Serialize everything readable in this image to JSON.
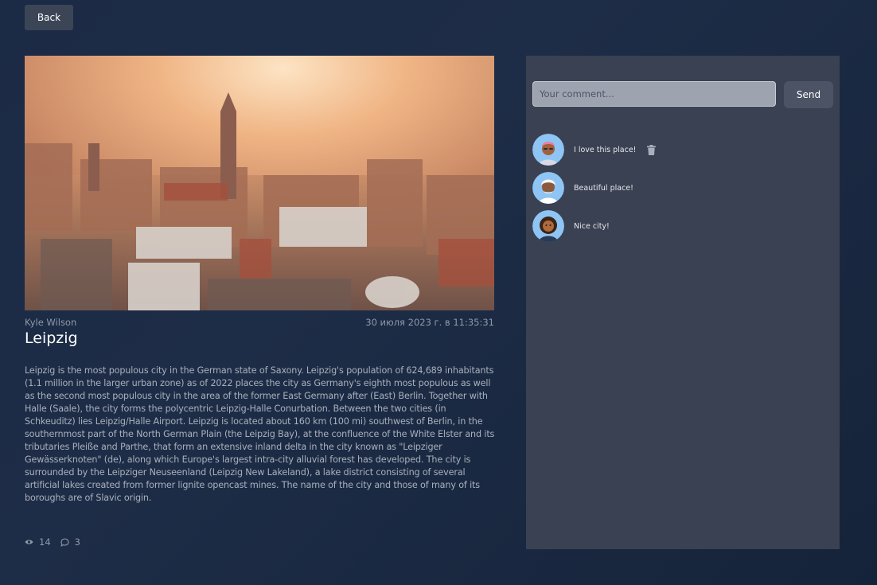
{
  "header": {
    "back_label": "Back"
  },
  "post": {
    "image_icon": "city-photo",
    "author": "Kyle Wilson",
    "date": "30 июля 2023 г. в 11:35:31",
    "title": "Leipzig",
    "description": "Leipzig is the most populous city in the German state of Saxony. Leipzig's population of 624,689 inhabitants (1.1 million in the larger urban zone) as of 2022 places the city as Germany's eighth most populous as well as the second most populous city in the area of the former East Germany after (East) Berlin. Together with Halle (Saale), the city forms the polycentric Leipzig-Halle Conurbation. Between the two cities (in Schkeuditz) lies Leipzig/Halle Airport. Leipzig is located about 160 km (100 mi) southwest of Berlin, in the southernmost part of the North German Plain (the Leipzig Bay), at the confluence of the White Elster and its tributaries Pleiße and Parthe, that form an extensive inland delta in the city known as \"Leipziger Gewässerknoten\" (de), along which Europe's largest intra-city alluvial forest has developed. The city is surrounded by the Leipziger Neuseenland (Leipzig New Lakeland), a lake district consisting of several artificial lakes created from former lignite opencast mines. The name of the city and those of many of its boroughs are of Slavic origin.",
    "views": "14",
    "comments_count": "3",
    "views_icon": "eye-icon",
    "comments_icon": "speech-bubble-icon"
  },
  "comments_panel": {
    "input_placeholder": "Your comment...",
    "input_value": "",
    "send_label": "Send",
    "delete_icon": "trash-icon",
    "items": [
      {
        "text": "I love this place!",
        "deletable": true,
        "avatar_icon": "avatar-pink-hair"
      },
      {
        "text": "Beautiful place!",
        "deletable": false,
        "avatar_icon": "avatar-white-hair"
      },
      {
        "text": "Nice city!",
        "deletable": false,
        "avatar_icon": "avatar-dark-curly"
      }
    ]
  },
  "colors": {
    "page_bg": "#1e2d47",
    "panel_bg": "#3a4152",
    "button_bg": "#3c4556",
    "avatar_bg": "#8ec5f5",
    "muted_text": "#8f98a8"
  }
}
